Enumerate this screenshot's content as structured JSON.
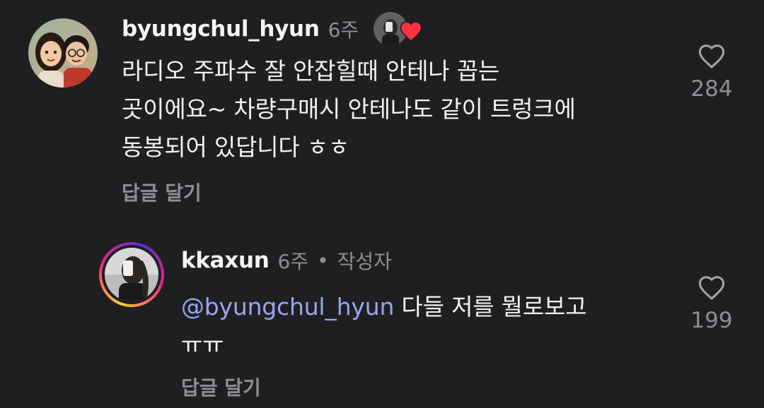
{
  "comment": {
    "username": "byungchul_hyun",
    "time": "6주",
    "lines": [
      "라디오 주파수 잘 안잡힐때 안테나 꼽는",
      "곳이에요~ 차량구매시 안테나도 같이 트렁크에",
      "동봉되어 있답니다 ㅎㅎ"
    ],
    "reply_label": "답글 달기",
    "like_count": "284",
    "liked_by_author": true,
    "icons": {
      "like": "heart-outline-icon",
      "liked_badge": "red-heart-icon"
    },
    "colors": {
      "heart_badge": "#ff3040"
    }
  },
  "reply": {
    "username": "kkaxun",
    "time": "6주",
    "separator": "•",
    "author_tag": "작성자",
    "mention": "@byungchul_hyun",
    "line1_rest": " 다들 저를 뭘로보고",
    "line2": "ㅠㅠ",
    "reply_label": "답글 달기",
    "like_count": "199",
    "icons": {
      "like": "heart-outline-icon",
      "mention_prefix": "threads-at-icon"
    },
    "colors": {
      "mention": "#9aa5f0"
    }
  }
}
